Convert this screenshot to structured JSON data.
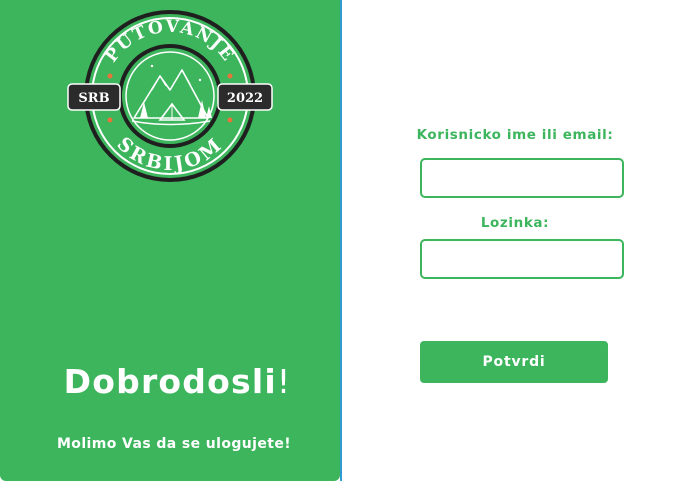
{
  "logo": {
    "top_text": "PUTOVANJE",
    "bottom_text": "SRBIJOM",
    "left_badge": "SRB",
    "right_badge": "2022",
    "icon": "mountain-camp-emblem"
  },
  "welcome": {
    "title": "Dobrodosli",
    "title_suffix": "!",
    "subtitle": "Molimo Vas da se ulogujete!"
  },
  "login_form": {
    "username_label": "Korisnicko ime ili email:",
    "username_value": "",
    "password_label": "Lozinka:",
    "password_value": "",
    "submit_label": "Potvrdi"
  },
  "colors": {
    "brand_green": "#3cb55c",
    "dark_green": "#2e9a4c",
    "badge_dark": "#2b2b2b",
    "accent_orange": "#e8743b",
    "divider_blue": "#2f9bd0"
  }
}
